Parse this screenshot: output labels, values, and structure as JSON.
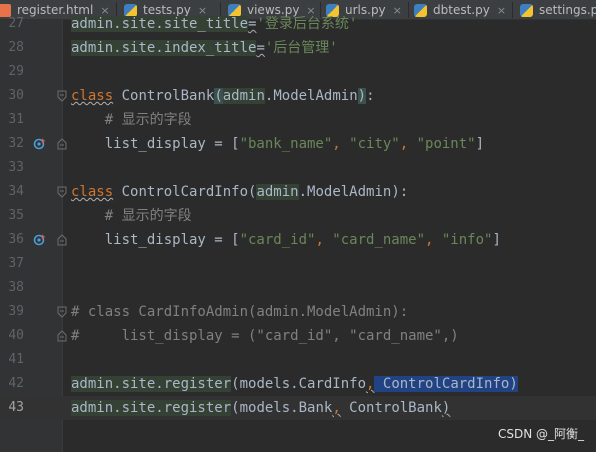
{
  "tabs": [
    {
      "label": "register.html",
      "icon": "html-file-icon"
    },
    {
      "label": "tests.py",
      "icon": "python-file-icon"
    },
    {
      "label": "views.py",
      "icon": "python-file-icon"
    },
    {
      "label": "urls.py",
      "icon": "python-file-icon"
    },
    {
      "label": "dbtest.py",
      "icon": "python-file-icon"
    },
    {
      "label": "settings.py",
      "icon": "python-file-icon"
    }
  ],
  "close_glyph": "×",
  "lines": [
    {
      "num": "27",
      "text": "admin.site.site_title='登录后台系统'"
    },
    {
      "num": "28",
      "text": "admin.site.index_title='后台管理'"
    },
    {
      "num": "29",
      "text": ""
    },
    {
      "num": "30",
      "text": "class ControlBank(admin.ModelAdmin):"
    },
    {
      "num": "31",
      "text": "    # 显示的字段"
    },
    {
      "num": "32",
      "text": "    list_display = [\"bank_name\", \"city\", \"point\"]"
    },
    {
      "num": "33",
      "text": ""
    },
    {
      "num": "34",
      "text": "class ControlCardInfo(admin.ModelAdmin):"
    },
    {
      "num": "35",
      "text": "    # 显示的字段"
    },
    {
      "num": "36",
      "text": "    list_display = [\"card_id\", \"card_name\", \"info\"]"
    },
    {
      "num": "37",
      "text": ""
    },
    {
      "num": "38",
      "text": ""
    },
    {
      "num": "39",
      "text": "# class CardInfoAdmin(admin.ModelAdmin):"
    },
    {
      "num": "40",
      "text": "#     list_display = (\"card_id\", \"card_name\",)"
    },
    {
      "num": "41",
      "text": ""
    },
    {
      "num": "42",
      "text": "admin.site.register(models.CardInfo, ControlCardInfo)"
    },
    {
      "num": "43",
      "text": "admin.site.register(models.Bank, ControlBank)"
    }
  ],
  "code_parts": {
    "l27_a": "admin.site.site_title",
    "l27_b": "=",
    "l27_c": "'登录后台系统'",
    "l28_a": "admin.site.index_title",
    "l28_b": "=",
    "l28_c": "'后台管理'",
    "l30_kw": "class",
    "l30_name": " ControlBank",
    "l30_p1": "(",
    "l30_base1": "admin",
    "l30_base2": ".ModelAdmin",
    "l30_p2": ")",
    "l30_colon": ":",
    "l31": "    # 显示的字段",
    "l32_a": "    list_display = [",
    "l32_s1": "\"bank_name\"",
    "l32_c1": ", ",
    "l32_s2": "\"city\"",
    "l32_c2": ", ",
    "l32_s3": "\"point\"",
    "l32_e": "]",
    "l34_kw": "class",
    "l34_name": " ControlCardInfo",
    "l34_p1": "(",
    "l34_base1": "admin",
    "l34_base2": ".ModelAdmin",
    "l34_p2": ")",
    "l34_colon": ":",
    "l35": "    # 显示的字段",
    "l36_a": "    list_display = [",
    "l36_s1": "\"card_id\"",
    "l36_c1": ", ",
    "l36_s2": "\"card_name\"",
    "l36_c2": ", ",
    "l36_s3": "\"info\"",
    "l36_e": "]",
    "l39": "# class CardInfoAdmin(admin.ModelAdmin):",
    "l40": "#     list_display = (\"card_id\", \"card_name\",)",
    "l42_a": "admin.site.register",
    "l42_p1": "(",
    "l42_b": "models.CardInfo",
    "l42_c": ",",
    "l42_sel": " ControlCardInfo",
    "l42_p2": ")",
    "l43_a": "admin.site.register",
    "l43_p1": "(",
    "l43_b": "models.Bank",
    "l43_c": ",",
    "l43_d": " ControlBank",
    "l43_p2": ")"
  },
  "watermark": "CSDN @_阿衡_",
  "colors": {
    "background": "#2b2b2b",
    "keyword": "#cc7832",
    "string": "#6a8759",
    "comment": "#808080",
    "selection": "#214283"
  }
}
